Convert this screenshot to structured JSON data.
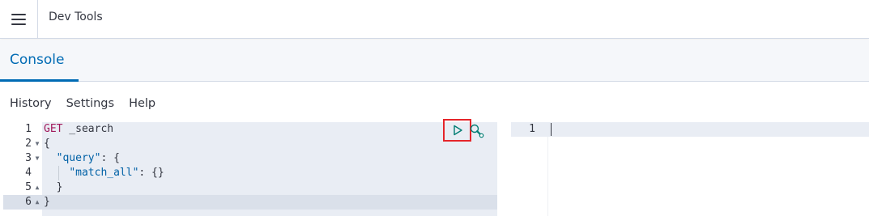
{
  "header": {
    "title": "Dev Tools",
    "menu_icon": "hamburger-icon"
  },
  "tabs": [
    {
      "label": "Console",
      "active": true
    }
  ],
  "subnav": {
    "history": "History",
    "settings": "Settings",
    "help": "Help"
  },
  "editor": {
    "lines": [
      {
        "num": "1",
        "fold": "",
        "code_kw": "GET",
        "code_rest": " _search"
      },
      {
        "num": "2",
        "fold": "▼",
        "code": "{"
      },
      {
        "num": "3",
        "fold": "▼",
        "code_pre": "  ",
        "code_key": "\"query\"",
        "code_post": ": {"
      },
      {
        "num": "4",
        "fold": "",
        "code_pre": "    ",
        "code_key": "\"match_all\"",
        "code_post": ": {}"
      },
      {
        "num": "5",
        "fold": "▲",
        "code": "  }"
      },
      {
        "num": "6",
        "fold": "▲",
        "code": "}"
      }
    ]
  },
  "output": {
    "lines": [
      {
        "num": "1"
      }
    ]
  },
  "actions": {
    "run_icon": "play-icon",
    "settings_icon": "wrench-icon"
  },
  "colors": {
    "accent": "#006bb4",
    "highlight_border": "#e5252a",
    "keyword": "#a21a5c",
    "string": "#0061a6",
    "run_icon": "#017d73"
  }
}
